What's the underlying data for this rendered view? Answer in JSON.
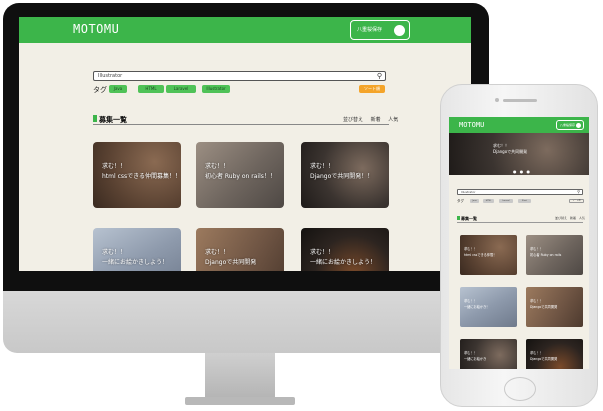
{
  "site": {
    "logo": "MOTOMU",
    "header_pill_label": "八重桜保存",
    "search_placeholder": "Illustrator",
    "search_icon_glyph": "⚲",
    "tags_label": "タグ",
    "tags": [
      "Java",
      "HTML",
      "Laravel",
      "Illustrator"
    ],
    "sort_button": "ソート順",
    "section_title": "募集一覧",
    "sort_options": [
      "並び替え",
      "新着",
      "人気"
    ]
  },
  "desktop_cards": [
    {
      "line1": "求む！！",
      "line2": "html cssできる仲間募集！！"
    },
    {
      "line1": "求む！！",
      "line2": "初心者 Ruby on rails！！"
    },
    {
      "line1": "求む！！",
      "line2": "Djangoで共同開発！！"
    },
    {
      "line1": "求む！！",
      "line2": "一緒にお絵かきしよう！"
    },
    {
      "line1": "求む！！",
      "line2": "Djangoで共同開発"
    },
    {
      "line1": "求む！！",
      "line2": "一緒にお絵かきしよう！"
    }
  ],
  "phone": {
    "logo": "MOTOMU",
    "pill_label": "八重桜保存",
    "hero_line1": "求む！！",
    "hero_line2": "Djangoで共同開発",
    "hero_dots": "● ● ●",
    "search_placeholder": "Illustrator",
    "tags_label": "タグ",
    "tags": [
      "Java",
      "HTML",
      "Laravel",
      "Illust"
    ],
    "sort_button": "ソート順",
    "section_title": "募集一覧",
    "sort_options": [
      "並び替え",
      "新着",
      "人気"
    ],
    "cards": [
      {
        "line1": "求む！！",
        "line2": "html cssできる仲間！"
      },
      {
        "line1": "求む！！",
        "line2": "初心者 Ruby on rails"
      },
      {
        "line1": "求む！！",
        "line2": "一緒にお絵かき！"
      },
      {
        "line1": "求む！！",
        "line2": "Djangoで共同開発"
      },
      {
        "line1": "求む！！",
        "line2": "一緒にお絵かき"
      },
      {
        "line1": "求む！！",
        "line2": "Djangoで共同開発"
      }
    ]
  },
  "colors": {
    "brand_green": "#3cb54a",
    "accent_orange": "#f4a42a",
    "background": "#f2efe6"
  }
}
